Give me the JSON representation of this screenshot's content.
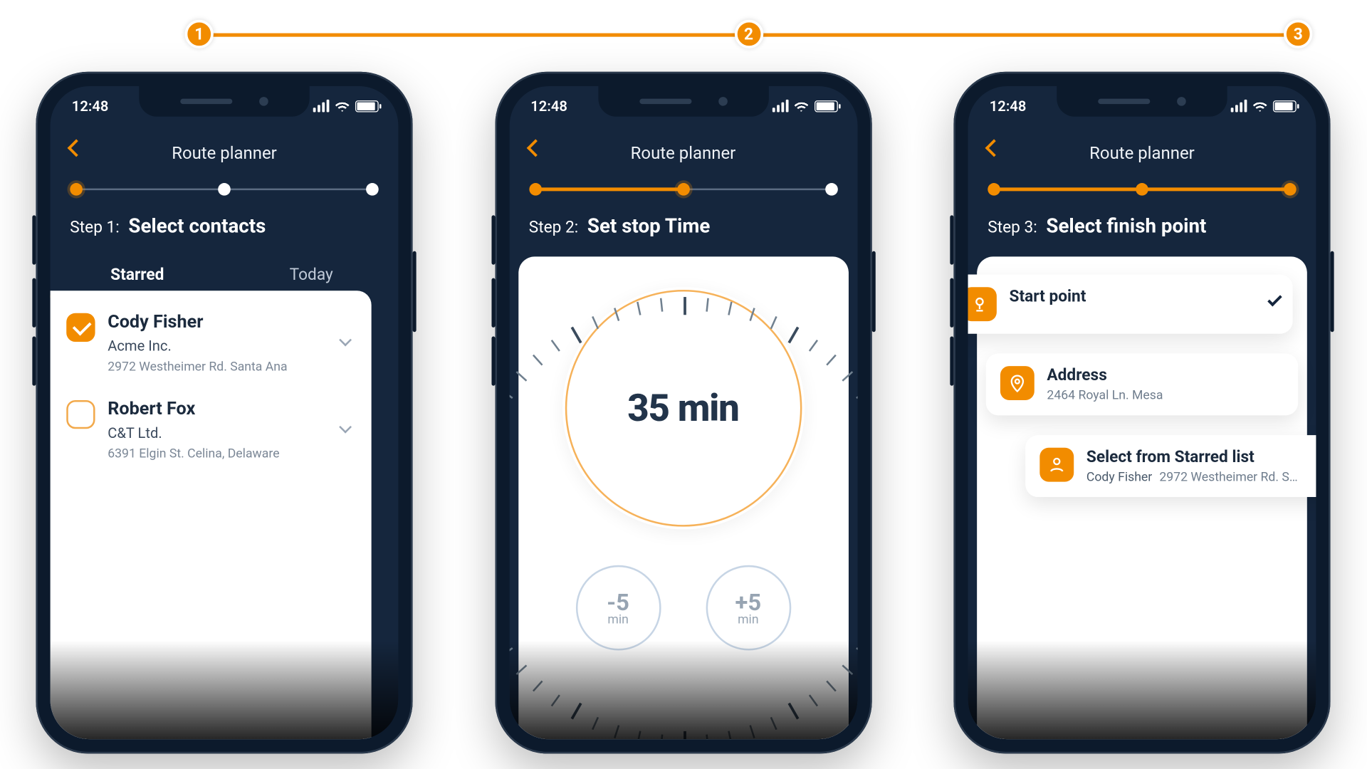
{
  "outer_steps": {
    "one": "1",
    "two": "2",
    "three": "3"
  },
  "status": {
    "time": "12:48"
  },
  "header": {
    "title": "Route planner"
  },
  "phone1": {
    "step_prefix": "Step 1:",
    "step_title": "Select contacts",
    "tabs": {
      "starred": "Starred",
      "today": "Today"
    },
    "contacts": [
      {
        "name": "Cody Fisher",
        "company": "Acme Inc.",
        "address": "2972 Westheimer Rd. Santa Ana",
        "checked": true
      },
      {
        "name": "Robert Fox",
        "company": "C&T Ltd.",
        "address": "6391 Elgin St. Celina, Delaware",
        "checked": false
      }
    ]
  },
  "phone2": {
    "step_prefix": "Step 2:",
    "step_title": "Set stop Time",
    "dial_value": "35 min",
    "minus": {
      "big": "-5",
      "small": "min"
    },
    "plus": {
      "big": "+5",
      "small": "min"
    }
  },
  "phone3": {
    "step_prefix": "Step 3:",
    "step_title": "Select finish point",
    "start": {
      "title": "Start point"
    },
    "address": {
      "title": "Address",
      "value": "2464 Royal Ln. Mesa"
    },
    "starred": {
      "title": "Select from Starred list",
      "name": "Cody Fisher",
      "addr": "2972 Westheimer Rd. S…"
    }
  }
}
